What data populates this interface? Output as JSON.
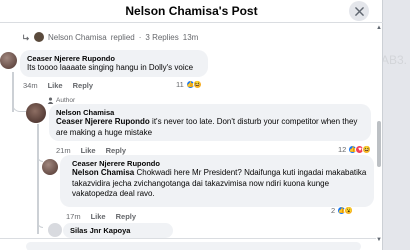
{
  "background_text": "AB3.",
  "header": {
    "title": "Nelson Chamisa's Post"
  },
  "replied_summary": {
    "name": "Nelson Chamisa",
    "action": "replied",
    "separator": "·",
    "replies": "3 Replies",
    "time": "13m"
  },
  "comments": [
    {
      "name": "Ceaser Njerere Rupondo",
      "text": "Its toooo laaaate singing hangu in Dolly's voice",
      "time": "34m",
      "like_label": "Like",
      "reply_label": "Reply",
      "reaction_count": "11",
      "reactions": [
        "like",
        "laugh"
      ]
    },
    {
      "author_badge": "Author",
      "name": "Nelson Chamisa",
      "mention": "Ceaser Njerere Rupondo",
      "text": " it's never too late. Don't disturb your competitor when they are making a huge mistake",
      "time": "21m",
      "like_label": "Like",
      "reply_label": "Reply",
      "reaction_count": "12",
      "reactions": [
        "like",
        "love",
        "laugh"
      ]
    },
    {
      "name": "Ceaser Njerere Rupondo",
      "mention": "Nelson Chamisa",
      "text": " Chokwadi here Mr President? Ndaifunga kuti ingadai makabatika takazvidira jecha zvichangotanga dai takazvimisa now ndiri kuona kunge vakatopedza deal ravo.",
      "time": "17m",
      "like_label": "Like",
      "reply_label": "Reply",
      "reaction_count": "2",
      "reactions": [
        "like",
        "wow"
      ]
    },
    {
      "name": "Silas Jnr Kapoya"
    }
  ],
  "colors": {
    "like_blue": "#1877f2",
    "bubble_gray": "#f0f2f5",
    "meta_gray": "#65676b"
  }
}
